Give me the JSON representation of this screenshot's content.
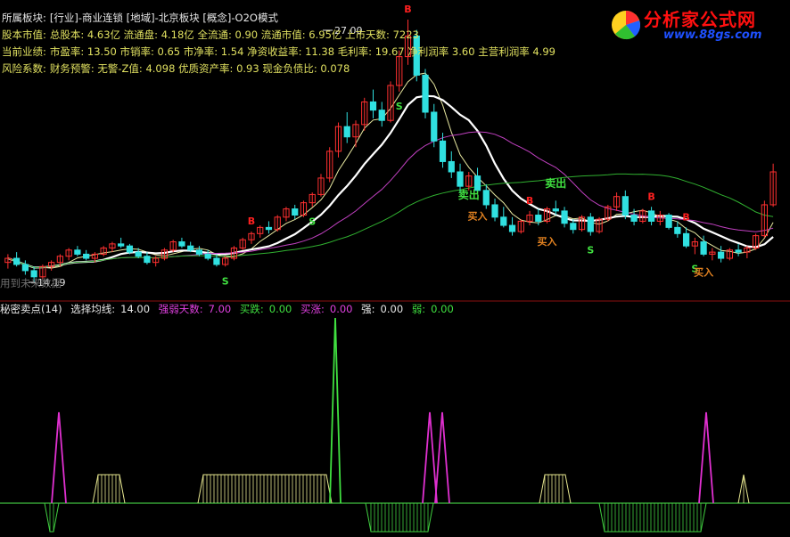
{
  "header": {
    "line1": {
      "label": "所属板块:",
      "value": "[行业]-商业连锁 [地域]-北京板块 [概念]-O2O模式"
    },
    "line2": {
      "label": "股本市值:",
      "value": "总股本: 4.63亿 流通盘: 4.18亿 全流通: 0.90 流通市值: 6.95亿 上市天数: 7223"
    },
    "line3": {
      "label": "当前业绩:",
      "value": "市盈率: 13.50 市销率: 0.65 市净率: 1.54 净资收益率: 11.38 毛利率: 19.67 净利润率 3.60 主营利润率 4.99"
    },
    "line4": {
      "label": "风险系数:",
      "value": "财务预警: 无警-Z值: 4.098 优质资产率: 0.93 现金负债比: 0.078"
    }
  },
  "watermark": {
    "title": "分析家公式网",
    "url": "www.88gs.com"
  },
  "main_chart_labels": {
    "high_price": "27.00",
    "low_price": "14.19",
    "unused_note": "用到未来数据",
    "sell_label": "卖出",
    "buy_label": "买入",
    "s_mark": "S",
    "b_mark": "B"
  },
  "indicator_bar": {
    "name": "秘密卖点(14)",
    "param_label": "选择均线:",
    "param_value": "14.00",
    "strength_days_label": "强弱天数:",
    "strength_days_value": "7.00",
    "buy_fall_label": "买跌:",
    "buy_fall_value": "0.00",
    "buy_rise_label": "买涨:",
    "buy_rise_value": "0.00",
    "strong_label": "强:",
    "strong_value": "0.00",
    "weak_label": "弱:",
    "weak_value": "0.00"
  },
  "colors": {
    "up": "#ff3030",
    "down": "#30e0e0",
    "ma_white": "#ffffff",
    "ma_yellow": "#e8e8a0",
    "ma_magenta": "#c040c0",
    "ma_green": "#30b030",
    "spike_magenta": "#e030d0",
    "spike_green": "#40e040",
    "band_yellow": "#e8e890",
    "band_green": "#40d040",
    "baseline": "#40c040"
  },
  "chart_data": {
    "type": "candlestick",
    "price_range": [
      14.19,
      27.0
    ],
    "high": 27.0,
    "low": 14.19,
    "candles_ohlc_approx": [
      [
        15.2,
        15.6,
        14.9,
        15.4
      ],
      [
        15.4,
        15.7,
        15.0,
        15.1
      ],
      [
        15.1,
        15.3,
        14.6,
        14.8
      ],
      [
        14.8,
        15.0,
        14.19,
        14.5
      ],
      [
        14.5,
        15.1,
        14.4,
        15.0
      ],
      [
        15.0,
        15.3,
        14.8,
        15.2
      ],
      [
        15.2,
        15.6,
        15.0,
        15.5
      ],
      [
        15.5,
        15.9,
        15.3,
        15.8
      ],
      [
        15.8,
        16.0,
        15.5,
        15.6
      ],
      [
        15.6,
        15.8,
        15.3,
        15.4
      ],
      [
        15.4,
        15.7,
        15.2,
        15.6
      ],
      [
        15.6,
        16.0,
        15.5,
        15.9
      ],
      [
        15.9,
        16.2,
        15.7,
        16.1
      ],
      [
        16.1,
        16.4,
        15.9,
        16.0
      ],
      [
        16.0,
        16.1,
        15.6,
        15.7
      ],
      [
        15.7,
        15.9,
        15.4,
        15.5
      ],
      [
        15.5,
        15.7,
        15.1,
        15.2
      ],
      [
        15.2,
        15.5,
        15.0,
        15.4
      ],
      [
        15.4,
        15.9,
        15.3,
        15.8
      ],
      [
        15.8,
        16.3,
        15.7,
        16.2
      ],
      [
        16.2,
        16.4,
        15.9,
        16.0
      ],
      [
        16.0,
        16.2,
        15.7,
        15.8
      ],
      [
        15.8,
        16.0,
        15.5,
        15.6
      ],
      [
        15.6,
        15.8,
        15.3,
        15.4
      ],
      [
        15.4,
        15.6,
        15.0,
        15.1
      ],
      [
        15.1,
        15.5,
        15.0,
        15.4
      ],
      [
        15.4,
        16.0,
        15.3,
        15.9
      ],
      [
        15.9,
        16.4,
        15.8,
        16.3
      ],
      [
        16.3,
        16.7,
        16.1,
        16.6
      ],
      [
        16.6,
        17.0,
        16.4,
        16.9
      ],
      [
        16.9,
        17.2,
        16.6,
        16.8
      ],
      [
        16.8,
        17.5,
        16.7,
        17.4
      ],
      [
        17.4,
        17.9,
        17.2,
        17.8
      ],
      [
        17.8,
        18.0,
        17.3,
        17.5
      ],
      [
        17.5,
        18.2,
        17.4,
        18.1
      ],
      [
        18.1,
        18.6,
        17.9,
        18.5
      ],
      [
        18.5,
        19.5,
        18.4,
        19.3
      ],
      [
        19.3,
        20.8,
        19.1,
        20.6
      ],
      [
        20.6,
        22.0,
        20.3,
        21.8
      ],
      [
        21.8,
        22.5,
        21.0,
        21.3
      ],
      [
        21.3,
        22.1,
        20.8,
        21.9
      ],
      [
        21.9,
        23.2,
        21.6,
        23.0
      ],
      [
        23.0,
        23.6,
        22.2,
        22.6
      ],
      [
        22.6,
        23.0,
        21.8,
        22.1
      ],
      [
        22.1,
        24.0,
        22.0,
        23.8
      ],
      [
        23.8,
        25.5,
        23.5,
        25.2
      ],
      [
        25.2,
        27.0,
        24.8,
        26.2
      ],
      [
        26.2,
        26.5,
        24.0,
        24.3
      ],
      [
        24.3,
        24.6,
        22.2,
        22.5
      ],
      [
        22.5,
        22.9,
        20.8,
        21.1
      ],
      [
        21.1,
        21.5,
        19.8,
        20.1
      ],
      [
        20.1,
        20.6,
        19.3,
        19.6
      ],
      [
        19.6,
        20.0,
        18.6,
        18.9
      ],
      [
        18.9,
        19.6,
        18.7,
        19.4
      ],
      [
        19.4,
        19.8,
        18.5,
        18.7
      ],
      [
        18.7,
        19.0,
        17.8,
        18.0
      ],
      [
        18.0,
        18.3,
        17.2,
        17.4
      ],
      [
        17.4,
        17.9,
        16.9,
        17.0
      ],
      [
        17.0,
        17.4,
        16.5,
        16.7
      ],
      [
        16.7,
        17.3,
        16.6,
        17.2
      ],
      [
        17.2,
        17.7,
        17.0,
        17.5
      ],
      [
        17.5,
        17.8,
        17.0,
        17.2
      ],
      [
        17.2,
        17.9,
        17.1,
        17.8
      ],
      [
        17.8,
        18.2,
        17.5,
        17.7
      ],
      [
        17.7,
        17.9,
        16.9,
        17.1
      ],
      [
        17.1,
        17.3,
        16.6,
        16.8
      ],
      [
        16.8,
        17.5,
        16.7,
        17.4
      ],
      [
        17.4,
        17.6,
        16.5,
        16.7
      ],
      [
        16.7,
        17.4,
        16.6,
        17.3
      ],
      [
        17.3,
        18.0,
        17.2,
        17.9
      ],
      [
        17.9,
        18.6,
        17.7,
        18.4
      ],
      [
        18.4,
        18.7,
        17.3,
        17.5
      ],
      [
        17.5,
        17.8,
        17.0,
        17.2
      ],
      [
        17.2,
        17.8,
        17.1,
        17.7
      ],
      [
        17.7,
        17.9,
        17.0,
        17.2
      ],
      [
        17.2,
        17.7,
        17.0,
        17.5
      ],
      [
        17.5,
        17.6,
        16.8,
        16.9
      ],
      [
        16.9,
        17.2,
        16.4,
        16.6
      ],
      [
        16.6,
        16.9,
        15.9,
        16.0
      ],
      [
        16.0,
        16.4,
        15.6,
        16.2
      ],
      [
        16.2,
        16.5,
        15.5,
        15.6
      ],
      [
        15.6,
        15.9,
        15.3,
        15.7
      ],
      [
        15.7,
        16.0,
        15.2,
        15.4
      ],
      [
        15.4,
        15.9,
        15.3,
        15.8
      ],
      [
        15.8,
        16.1,
        15.5,
        15.7
      ],
      [
        15.7,
        16.0,
        15.4,
        15.9
      ],
      [
        15.9,
        16.6,
        15.8,
        16.5
      ],
      [
        16.5,
        18.2,
        16.4,
        18.0
      ],
      [
        18.0,
        20.0,
        17.9,
        19.6
      ]
    ],
    "indicator": {
      "param_ma": 14.0,
      "strength_days": 7.0,
      "values": {
        "buy_fall": 0.0,
        "buy_rise": 0.0,
        "strong": 0.0,
        "weak": 0.0
      }
    }
  }
}
